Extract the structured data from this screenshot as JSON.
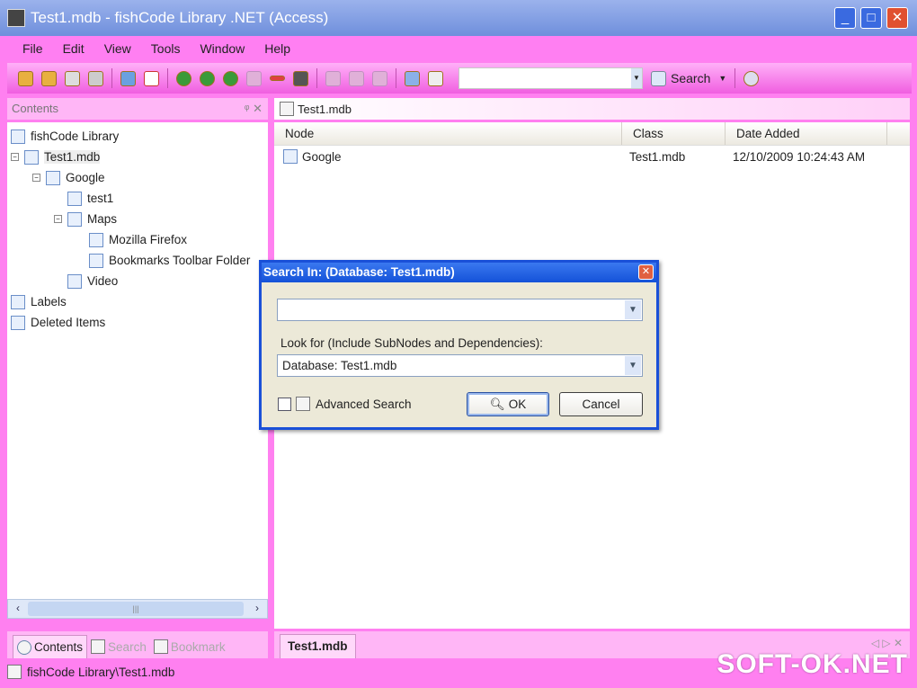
{
  "window": {
    "title": "Test1.mdb - fishCode Library .NET (Access)"
  },
  "menu": [
    "File",
    "Edit",
    "View",
    "Tools",
    "Window",
    "Help"
  ],
  "toolbar": {
    "search_value": "",
    "search_label": "Search"
  },
  "contents_pane": {
    "title": "Contents",
    "tree": [
      {
        "label": "fishCode Library",
        "level": 0,
        "toggle": ""
      },
      {
        "label": "Test1.mdb",
        "level": 0,
        "toggle": "−",
        "selected": true
      },
      {
        "label": "Google",
        "level": 1,
        "toggle": "−"
      },
      {
        "label": "test1",
        "level": 2,
        "toggle": ""
      },
      {
        "label": "Maps",
        "level": 2,
        "toggle": "−"
      },
      {
        "label": "Mozilla Firefox",
        "level": 3,
        "toggle": ""
      },
      {
        "label": "Bookmarks Toolbar Folder",
        "level": 3,
        "toggle": ""
      },
      {
        "label": "Video",
        "level": 2,
        "toggle": ""
      },
      {
        "label": "Labels",
        "level": 0,
        "toggle": ""
      },
      {
        "label": "Deleted Items",
        "level": 0,
        "toggle": ""
      }
    ],
    "tabs": [
      "Contents",
      "Search",
      "Bookmark"
    ]
  },
  "document": {
    "tab_title": "Test1.mdb",
    "bottom_tab": "Test1.mdb",
    "columns": [
      "Node",
      "Class",
      "Date Added"
    ],
    "rows": [
      {
        "node": "Google",
        "class": "Test1.mdb",
        "date_added": "12/10/2009 10:24:43 AM"
      }
    ]
  },
  "dialog": {
    "title": "Search In: (Database: Test1.mdb)",
    "search_value": "",
    "look_for_label": "Look for (Include SubNodes and Dependencies):",
    "look_for_value": "Database: Test1.mdb",
    "advanced_label": "Advanced Search",
    "advanced_checked": false,
    "ok_label": "OK",
    "cancel_label": "Cancel"
  },
  "status": {
    "path": "fishCode Library\\Test1.mdb"
  },
  "watermark": "SOFT-OK.NET",
  "colors": {
    "chrome": "#ff80f0",
    "titlebar": "#6f8fdc",
    "dialog_border": "#1a50d8"
  }
}
